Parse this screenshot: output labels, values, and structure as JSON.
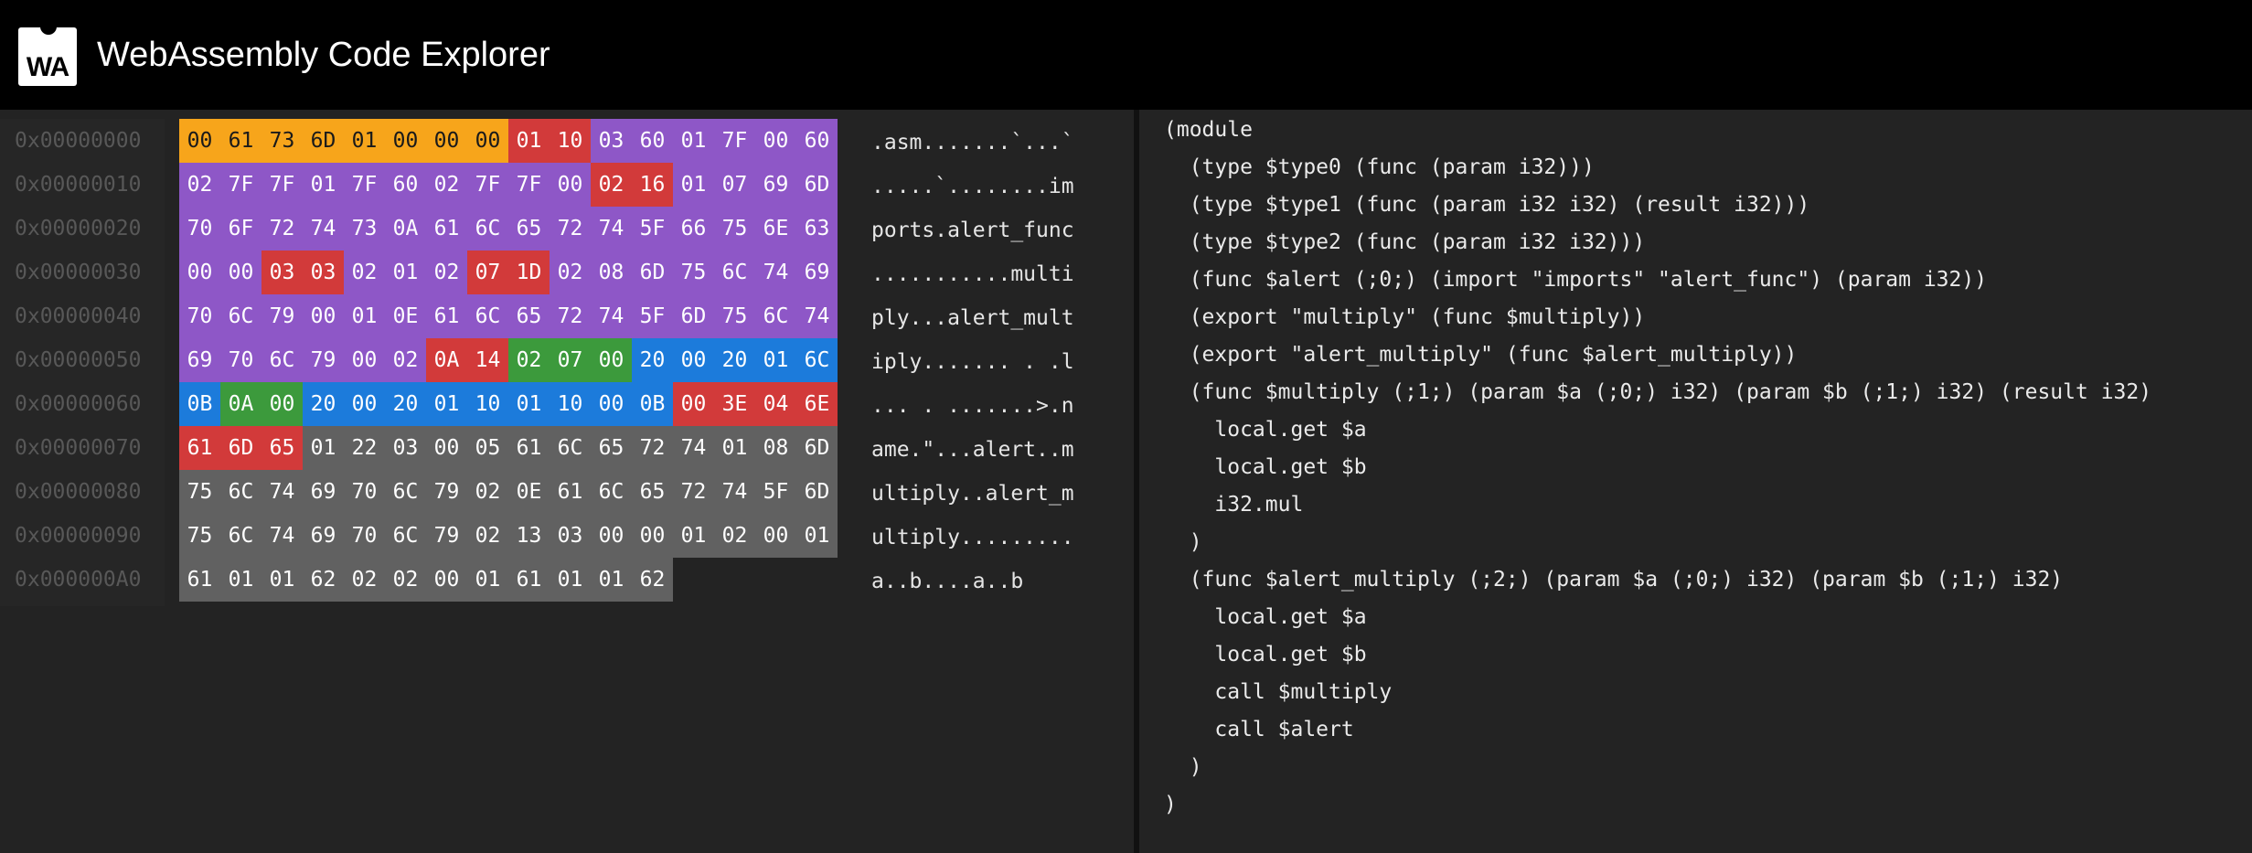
{
  "header": {
    "logo_text": "WA",
    "title": "WebAssembly Code Explorer"
  },
  "colors": {
    "header_bg": "#000000",
    "panel_bg": "#232323",
    "address_text": "#585858",
    "magic": "#f7a51b",
    "section_header": "#d23a3a",
    "type_section": "#8e57c7",
    "code_body": "#1c7bdb",
    "locals": "#3c9a3c",
    "data": "#616161"
  },
  "hex_view": {
    "addresses": [
      "0x00000000",
      "0x00000010",
      "0x00000020",
      "0x00000030",
      "0x00000040",
      "0x00000050",
      "0x00000060",
      "0x00000070",
      "0x00000080",
      "0x00000090",
      "0x000000A0"
    ],
    "rows": [
      {
        "bytes": [
          "00",
          "61",
          "73",
          "6D",
          "01",
          "00",
          "00",
          "00",
          "01",
          "10",
          "03",
          "60",
          "01",
          "7F",
          "00",
          "60"
        ],
        "kinds": [
          "y",
          "y",
          "y",
          "y",
          "y",
          "y",
          "y",
          "y",
          "r",
          "r",
          "p",
          "p",
          "p",
          "p",
          "p",
          "p"
        ]
      },
      {
        "bytes": [
          "02",
          "7F",
          "7F",
          "01",
          "7F",
          "60",
          "02",
          "7F",
          "7F",
          "00",
          "02",
          "16",
          "01",
          "07",
          "69",
          "6D"
        ],
        "kinds": [
          "p",
          "p",
          "p",
          "p",
          "p",
          "p",
          "p",
          "p",
          "p",
          "p",
          "r",
          "r",
          "p",
          "p",
          "p",
          "p"
        ]
      },
      {
        "bytes": [
          "70",
          "6F",
          "72",
          "74",
          "73",
          "0A",
          "61",
          "6C",
          "65",
          "72",
          "74",
          "5F",
          "66",
          "75",
          "6E",
          "63"
        ],
        "kinds": [
          "p",
          "p",
          "p",
          "p",
          "p",
          "p",
          "p",
          "p",
          "p",
          "p",
          "p",
          "p",
          "p",
          "p",
          "p",
          "p"
        ]
      },
      {
        "bytes": [
          "00",
          "00",
          "03",
          "03",
          "02",
          "01",
          "02",
          "07",
          "1D",
          "02",
          "08",
          "6D",
          "75",
          "6C",
          "74",
          "69"
        ],
        "kinds": [
          "p",
          "p",
          "r",
          "r",
          "p",
          "p",
          "p",
          "r",
          "r",
          "p",
          "p",
          "p",
          "p",
          "p",
          "p",
          "p"
        ]
      },
      {
        "bytes": [
          "70",
          "6C",
          "79",
          "00",
          "01",
          "0E",
          "61",
          "6C",
          "65",
          "72",
          "74",
          "5F",
          "6D",
          "75",
          "6C",
          "74"
        ],
        "kinds": [
          "p",
          "p",
          "p",
          "p",
          "p",
          "p",
          "p",
          "p",
          "p",
          "p",
          "p",
          "p",
          "p",
          "p",
          "p",
          "p"
        ]
      },
      {
        "bytes": [
          "69",
          "70",
          "6C",
          "79",
          "00",
          "02",
          "0A",
          "14",
          "02",
          "07",
          "00",
          "20",
          "00",
          "20",
          "01",
          "6C"
        ],
        "kinds": [
          "p",
          "p",
          "p",
          "p",
          "p",
          "p",
          "r",
          "r",
          "g",
          "g",
          "g",
          "b",
          "b",
          "b",
          "b",
          "b"
        ]
      },
      {
        "bytes": [
          "0B",
          "0A",
          "00",
          "20",
          "00",
          "20",
          "01",
          "10",
          "01",
          "10",
          "00",
          "0B",
          "00",
          "3E",
          "04",
          "6E"
        ],
        "kinds": [
          "b",
          "g",
          "g",
          "b",
          "b",
          "b",
          "b",
          "b",
          "b",
          "b",
          "b",
          "b",
          "r",
          "r",
          "r",
          "r"
        ]
      },
      {
        "bytes": [
          "61",
          "6D",
          "65",
          "01",
          "22",
          "03",
          "00",
          "05",
          "61",
          "6C",
          "65",
          "72",
          "74",
          "01",
          "08",
          "6D"
        ],
        "kinds": [
          "r",
          "r",
          "r",
          "d",
          "d",
          "d",
          "d",
          "d",
          "d",
          "d",
          "d",
          "d",
          "d",
          "d",
          "d",
          "d"
        ]
      },
      {
        "bytes": [
          "75",
          "6C",
          "74",
          "69",
          "70",
          "6C",
          "79",
          "02",
          "0E",
          "61",
          "6C",
          "65",
          "72",
          "74",
          "5F",
          "6D"
        ],
        "kinds": [
          "d",
          "d",
          "d",
          "d",
          "d",
          "d",
          "d",
          "d",
          "d",
          "d",
          "d",
          "d",
          "d",
          "d",
          "d",
          "d"
        ]
      },
      {
        "bytes": [
          "75",
          "6C",
          "74",
          "69",
          "70",
          "6C",
          "79",
          "02",
          "13",
          "03",
          "00",
          "00",
          "01",
          "02",
          "00",
          "01"
        ],
        "kinds": [
          "d",
          "d",
          "d",
          "d",
          "d",
          "d",
          "d",
          "d",
          "d",
          "d",
          "d",
          "d",
          "d",
          "d",
          "d",
          "d"
        ]
      },
      {
        "bytes": [
          "61",
          "01",
          "01",
          "62",
          "02",
          "02",
          "00",
          "01",
          "61",
          "01",
          "01",
          "62"
        ],
        "kinds": [
          "d",
          "d",
          "d",
          "d",
          "d",
          "d",
          "d",
          "d",
          "d",
          "d",
          "d",
          "d"
        ]
      }
    ],
    "ascii": [
      ".asm.......`...`",
      ".....`........im",
      "ports.alert_func",
      "...........multi",
      "ply...alert_mult",
      "iply....... . .l",
      "... . .......>.n",
      "ame.\"...alert..m",
      "ultiply..alert_m",
      "ultiply.........",
      "a..b....a..b"
    ]
  },
  "code_view": {
    "lines": [
      "(module",
      "  (type $type0 (func (param i32)))",
      "  (type $type1 (func (param i32 i32) (result i32)))",
      "  (type $type2 (func (param i32 i32)))",
      "  (func $alert (;0;) (import \"imports\" \"alert_func\") (param i32))",
      "  (export \"multiply\" (func $multiply))",
      "  (export \"alert_multiply\" (func $alert_multiply))",
      "  (func $multiply (;1;) (param $a (;0;) i32) (param $b (;1;) i32) (result i32)",
      "    local.get $a",
      "    local.get $b",
      "    i32.mul",
      "  )",
      "  (func $alert_multiply (;2;) (param $a (;0;) i32) (param $b (;1;) i32)",
      "    local.get $a",
      "    local.get $b",
      "    call $multiply",
      "    call $alert",
      "  )",
      ")"
    ]
  }
}
